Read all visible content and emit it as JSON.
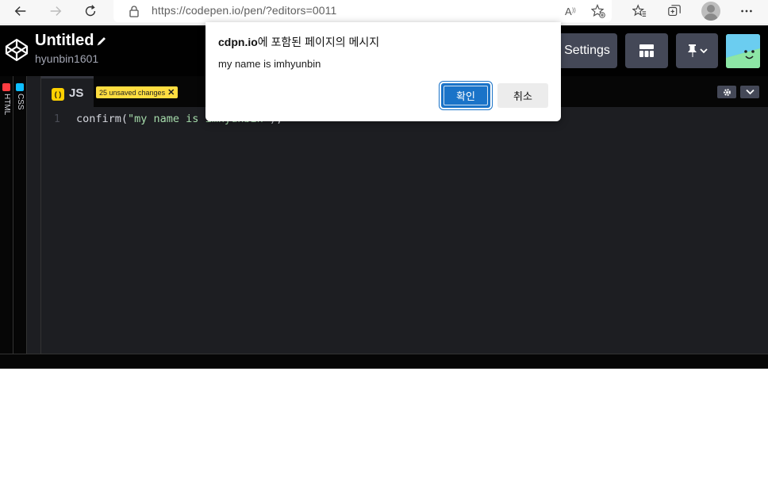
{
  "browser": {
    "url": "https://codepen.io/pen/?editors=0011"
  },
  "pen": {
    "title": "Untitled",
    "user": "hyunbin1601"
  },
  "header": {
    "settings_label": "Settings"
  },
  "side_panels": {
    "html_label": "HTML",
    "css_label": "CSS"
  },
  "editor": {
    "tab_label": "JS",
    "unsaved_badge": "25 unsaved changes",
    "line_number": "1",
    "code_fn": "confirm(",
    "code_str": "\"my name is imhyunbin\"",
    "code_end": ");"
  },
  "dialog": {
    "title_domain": "cdpn.io",
    "title_rest": "에 포함된 페이지의 메시지",
    "message": "my name is imhyunbin",
    "ok_label": "확인",
    "cancel_label": "취소"
  },
  "colors": {
    "codepen_bg": "#010101",
    "editor_bg": "#1d1e22",
    "unsaved_badge": "#ffdd40",
    "dialog_ok": "#1a73c8"
  },
  "icons": [
    "back-arrow-icon",
    "forward-arrow-icon",
    "refresh-icon",
    "lock-icon",
    "read-aloud-icon",
    "add-favorite-icon",
    "favorites-icon",
    "collections-icon",
    "profile-icon",
    "more-icon",
    "codepen-logo-icon",
    "pencil-icon",
    "layout-icon",
    "pin-icon",
    "gear-icon",
    "chevron-down-icon"
  ]
}
